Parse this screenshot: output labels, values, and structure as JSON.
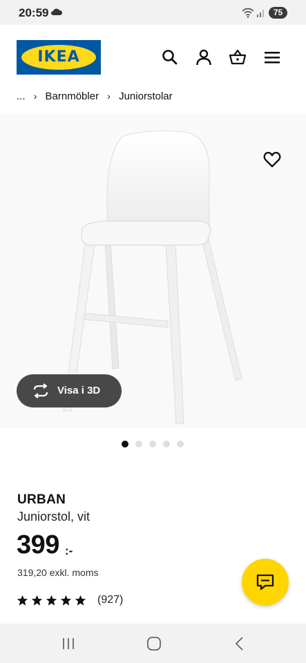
{
  "status": {
    "time": "20:59",
    "battery": "75"
  },
  "header": {
    "logo_text": "IKEA",
    "icons": [
      "search-icon",
      "account-icon",
      "cart-icon",
      "menu-icon"
    ]
  },
  "breadcrumb": {
    "ellipsis": "...",
    "separator": "›",
    "items": [
      "Barnmöbler",
      "Juniorstolar"
    ]
  },
  "product": {
    "name": "URBAN",
    "description": "Juniorstol, vit",
    "price": "399",
    "price_suffix": ":-",
    "price_ex_vat": "319,20 exkl. moms",
    "rating_stars": 5,
    "rating_count": "(927)"
  },
  "gallery": {
    "view_3d_label": "Visa i 3D",
    "image_count": 5,
    "active_image": 1
  },
  "colors": {
    "brand_blue": "#0058a3",
    "brand_yellow": "#ffda1a",
    "chat_yellow": "#ffd500",
    "dark_pill": "#484848"
  }
}
